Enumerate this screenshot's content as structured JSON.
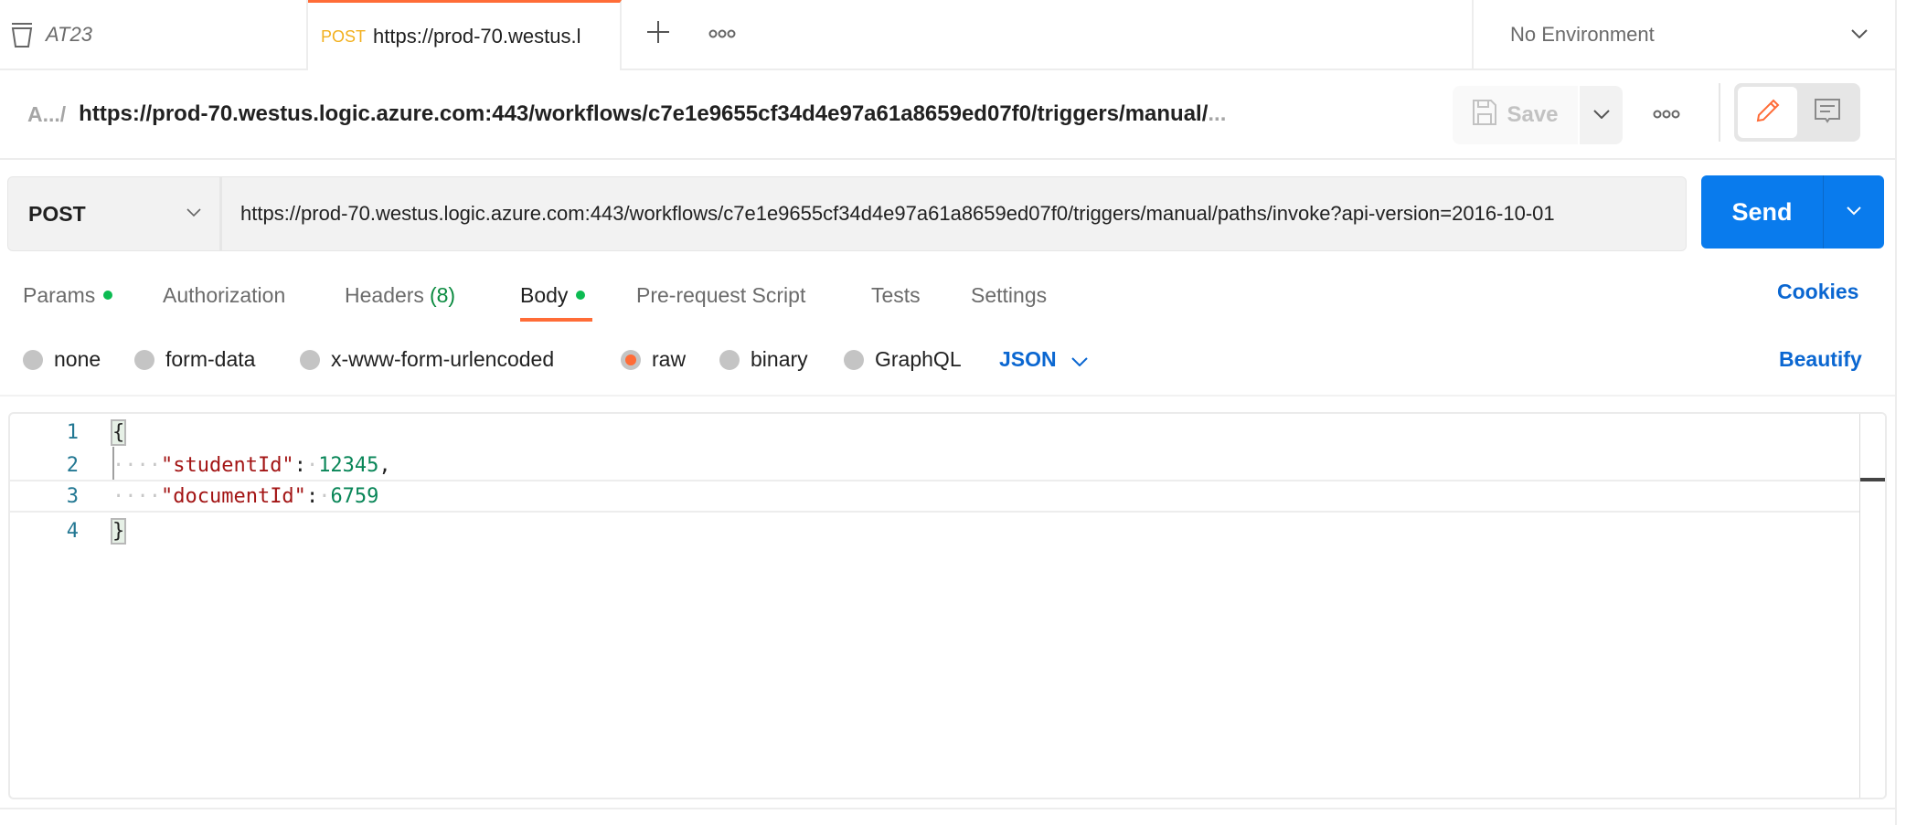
{
  "tabs": {
    "collection": {
      "label": "AT23",
      "icon": "trash-icon"
    },
    "active": {
      "method": "POST",
      "url": "https://prod-70.westus.l"
    },
    "add_icon": "plus-icon",
    "more_icon": "more-horizontal-icon"
  },
  "environment": {
    "label": "No Environment"
  },
  "breadcrumb": {
    "prefix": "A.../",
    "title": "https://prod-70.westus.logic.azure.com:443/workflows/c7e1e9655cf34d4e97a61a8659ed07f0/triggers/manual/",
    "ellipsis": "..."
  },
  "toolbar": {
    "save_label": "Save",
    "save_icon": "floppy-disk-icon",
    "more_icon": "more-horizontal-icon",
    "edit_icon": "pencil-icon",
    "comments_icon": "comment-icon"
  },
  "request": {
    "method": "POST",
    "url": "https://prod-70.westus.logic.azure.com:443/workflows/c7e1e9655cf34d4e97a61a8659ed07f0/triggers/manual/paths/invoke?api-version=2016-10-01",
    "send_label": "Send"
  },
  "request_tabs": [
    {
      "label": "Params",
      "dot": true,
      "active": false
    },
    {
      "label": "Authorization",
      "dot": false,
      "active": false
    },
    {
      "label": "Headers",
      "count": "(8)",
      "active": false
    },
    {
      "label": "Body",
      "dot": true,
      "active": true
    },
    {
      "label": "Pre-request Script",
      "active": false
    },
    {
      "label": "Tests",
      "active": false
    },
    {
      "label": "Settings",
      "active": false
    }
  ],
  "cookies_label": "Cookies",
  "body_types": [
    {
      "label": "none",
      "selected": false
    },
    {
      "label": "form-data",
      "selected": false
    },
    {
      "label": "x-www-form-urlencoded",
      "selected": false
    },
    {
      "label": "raw",
      "selected": true
    },
    {
      "label": "binary",
      "selected": false
    },
    {
      "label": "GraphQL",
      "selected": false
    }
  ],
  "body_format": "JSON",
  "beautify_label": "Beautify",
  "editor": {
    "lines": [
      {
        "n": "1"
      },
      {
        "n": "2",
        "key": "\"studentId\"",
        "value": "12345",
        "trailing": ","
      },
      {
        "n": "3",
        "key": "\"documentId\"",
        "value": "6759",
        "trailing": ""
      },
      {
        "n": "4"
      }
    ],
    "open_brace": "{",
    "close_brace": "}",
    "indent_dots": "····",
    "colon": ":",
    "space_dot": "·"
  },
  "colors": {
    "accent": "#ff6c37",
    "primary": "#097bed",
    "link": "#0b67d1",
    "success_dot": "#0cbb52",
    "method_post": "#f2b01e"
  }
}
